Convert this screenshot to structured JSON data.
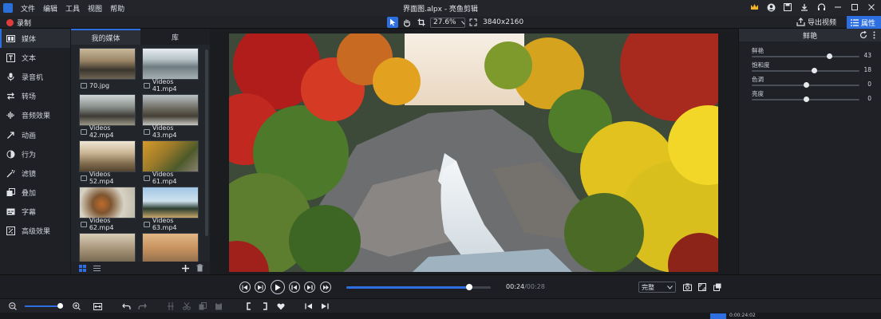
{
  "window": {
    "title": "界面图.alpx - 亮鱼剪辑",
    "menu": [
      "文件",
      "编辑",
      "工具",
      "视图",
      "帮助"
    ]
  },
  "toolbar": {
    "record_label": "录制",
    "zoom_value": "27.6%",
    "resolution": "3840x2160",
    "export_label": "导出视频",
    "properties_label": "属性"
  },
  "sidebar": {
    "items": [
      {
        "label": "媒体",
        "icon": "media-icon",
        "active": true
      },
      {
        "label": "文本",
        "icon": "text-icon"
      },
      {
        "label": "录音机",
        "icon": "microphone-icon"
      },
      {
        "label": "转场",
        "icon": "transition-icon"
      },
      {
        "label": "音频效果",
        "icon": "audio-effect-icon"
      },
      {
        "label": "动画",
        "icon": "animation-icon"
      },
      {
        "label": "行为",
        "icon": "behavior-icon"
      },
      {
        "label": "滤镜",
        "icon": "filter-icon"
      },
      {
        "label": "叠加",
        "icon": "overlay-icon"
      },
      {
        "label": "字幕",
        "icon": "subtitle-icon"
      },
      {
        "label": "高级效果",
        "icon": "advanced-effect-icon"
      }
    ]
  },
  "library": {
    "tabs": [
      "我的媒体",
      "库"
    ],
    "items": [
      {
        "label": "70.jpg",
        "kind": "image"
      },
      {
        "label": "Videos 41.mp4",
        "kind": "video"
      },
      {
        "label": "Videos 42.mp4",
        "kind": "video"
      },
      {
        "label": "Videos 43.mp4",
        "kind": "video"
      },
      {
        "label": "Videos 52.mp4",
        "kind": "video"
      },
      {
        "label": "Videos 61.mp4",
        "kind": "video"
      },
      {
        "label": "Videos 62.mp4",
        "kind": "video"
      },
      {
        "label": "Videos 63.mp4",
        "kind": "video"
      },
      {
        "label": "",
        "kind": "video"
      },
      {
        "label": "",
        "kind": "video"
      }
    ]
  },
  "properties": {
    "header": "鲜艳",
    "rows": [
      {
        "name": "鲜艳",
        "value": "43",
        "fraction": 0.72
      },
      {
        "name": "饱和度",
        "value": "18",
        "fraction": 0.58
      },
      {
        "name": "色调",
        "value": "0",
        "fraction": 0.5
      },
      {
        "name": "亮度",
        "value": "0",
        "fraction": 0.5
      }
    ]
  },
  "player": {
    "current_time": "00:24",
    "total_time": "/00:28",
    "progress": 0.85,
    "fit_option": "完整"
  },
  "timeline": {
    "zoom_fraction": 1.0,
    "marker_time": "0:00:24:02"
  },
  "colors": {
    "accent": "#2d6fe0",
    "record": "#e23b3b",
    "background": "#1b1d22"
  }
}
